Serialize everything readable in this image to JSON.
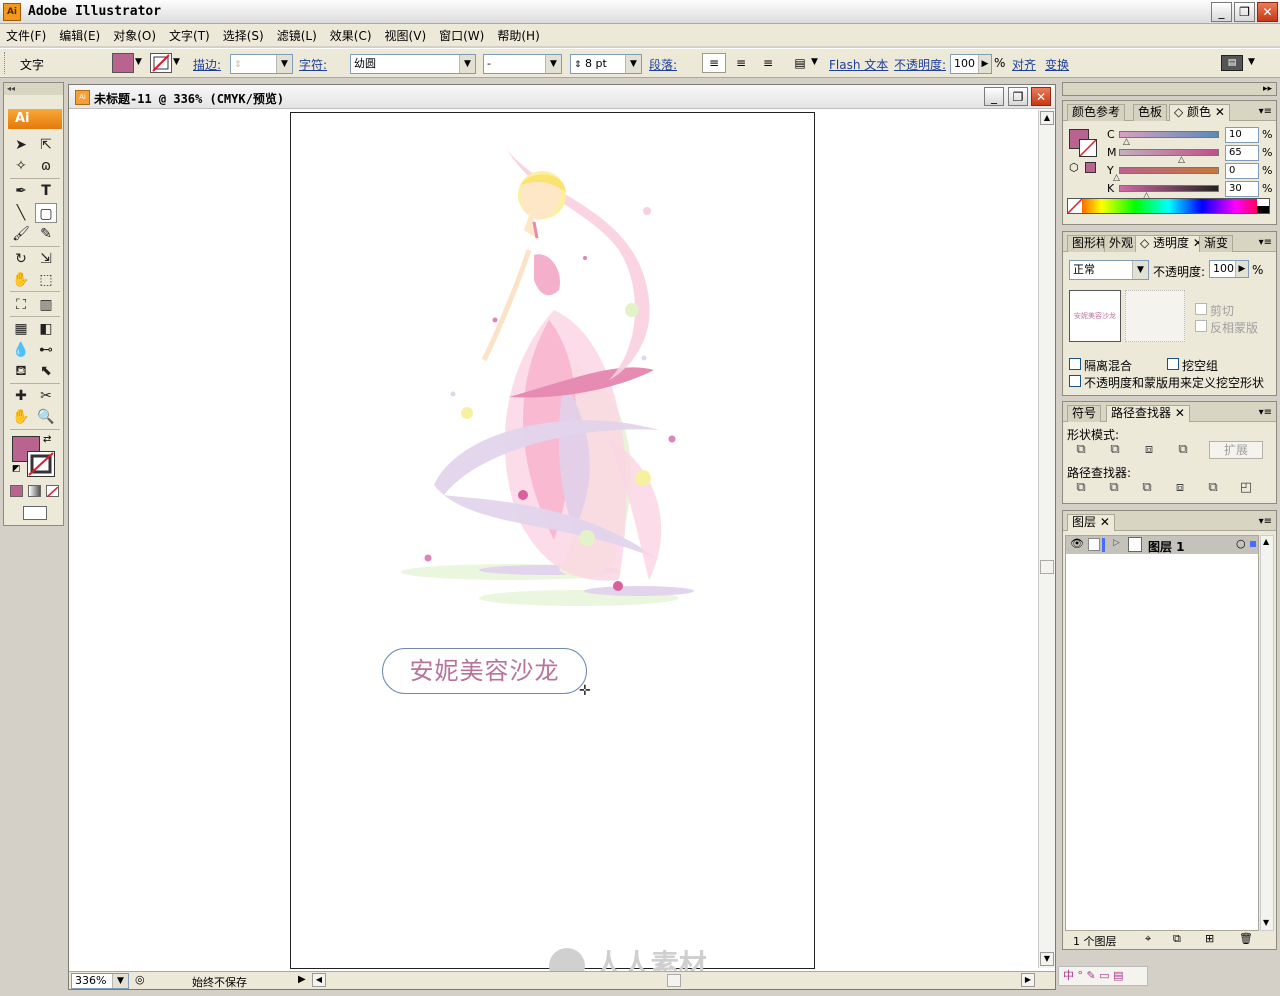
{
  "app": {
    "title": "Adobe Illustrator",
    "icon_label": "Ai",
    "window_buttons": [
      "_",
      "❐",
      "✕"
    ]
  },
  "menu": [
    "文件(F)",
    "编辑(E)",
    "对象(O)",
    "文字(T)",
    "选择(S)",
    "滤镜(L)",
    "效果(C)",
    "视图(V)",
    "窗口(W)",
    "帮助(H)"
  ],
  "controlbar": {
    "tool_name": "文字",
    "fill_color": "#b8648e",
    "stroke_label": "描边:",
    "char_label": "字符:",
    "font_name": "幼圆",
    "font_style": "-",
    "font_size": "8 pt",
    "para_label": "段落:",
    "flash_text": "Flash 文本",
    "opacity_label": "不透明度:",
    "opacity_value": "100",
    "percent": "%",
    "align_label": "对齐",
    "transform_label": "变换"
  },
  "toolbox": {
    "grip": "◂◂",
    "logo": "Ai",
    "fill_color": "#b8648e"
  },
  "document": {
    "title": "未标题-11 @ 336% (CMYK/预览)",
    "doc_icon": "Ai",
    "salon_text": "安妮美容沙龙",
    "zoom": "336%",
    "status": "始终不保存",
    "watermark": "人人素材"
  },
  "color_panel": {
    "tabs": [
      "颜色参考",
      "色板",
      "◇ 颜色"
    ],
    "channels": [
      {
        "name": "C",
        "value": "10",
        "fraction": 0.1
      },
      {
        "name": "M",
        "value": "65",
        "fraction": 0.65
      },
      {
        "name": "Y",
        "value": "0",
        "fraction": 0.0
      },
      {
        "name": "K",
        "value": "30",
        "fraction": 0.3
      }
    ],
    "percent": "%"
  },
  "transparency_panel": {
    "tabs": [
      "图形样",
      "外观",
      "◇ 透明度",
      "渐变"
    ],
    "blend_mode": "正常",
    "opacity_label": "不透明度:",
    "opacity_value": "100",
    "percent": "%",
    "thumb_text": "安妮美容沙龙",
    "clip_label": "剪切",
    "invert_mask_label": "反相蒙版",
    "isolate_label": "隔离混合",
    "knockout_label": "挖空组",
    "opacity_mask_label": "不透明度和蒙版用来定义挖空形状"
  },
  "pathfinder_panel": {
    "tabs": [
      "符号",
      "路径查找器"
    ],
    "shape_modes_label": "形状模式:",
    "expand_button": "扩展",
    "pathfinders_label": "路径查找器:"
  },
  "layers_panel": {
    "tab": "图层",
    "layer_name": "图层 1",
    "footer_count": "1 个图层",
    "layer_color": "#4a6cff"
  }
}
